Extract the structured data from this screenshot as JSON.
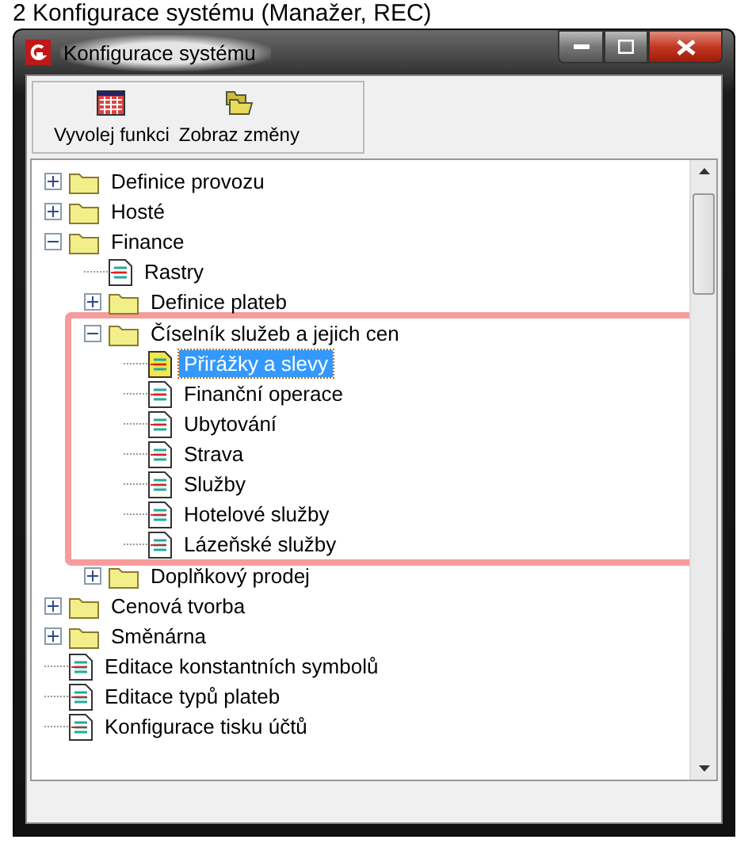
{
  "caption": "2 Konfigurace systému (Manažer, REC)",
  "window": {
    "title": "Konfigurace systému"
  },
  "toolbar": [
    {
      "label": "Vyvolej funkci",
      "kind": "calendar"
    },
    {
      "label": "Zobraz změny",
      "kind": "folders"
    }
  ],
  "tree": [
    {
      "label": "Definice provozu",
      "kind": "folder",
      "expanded": false,
      "selected": false
    },
    {
      "label": "Hosté",
      "kind": "folder",
      "expanded": false,
      "selected": false
    },
    {
      "label": "Finance",
      "kind": "folder",
      "expanded": true,
      "selected": false,
      "children": [
        {
          "label": "Rastry",
          "kind": "document",
          "selected": false
        },
        {
          "label": "Definice plateb",
          "kind": "folder",
          "expanded": false,
          "selected": false
        },
        {
          "label": "Číselník služeb a jejich cen",
          "kind": "folder",
          "expanded": true,
          "selected": false,
          "highlighted": true,
          "children": [
            {
              "label": "Přirážky a slevy",
              "kind": "document",
              "selected": true
            },
            {
              "label": "Finanční operace",
              "kind": "document",
              "selected": false
            },
            {
              "label": "Ubytování",
              "kind": "document",
              "selected": false
            },
            {
              "label": "Strava",
              "kind": "document",
              "selected": false
            },
            {
              "label": "Služby",
              "kind": "document",
              "selected": false
            },
            {
              "label": "Hotelové služby",
              "kind": "document",
              "selected": false
            },
            {
              "label": "Lázeňské služby",
              "kind": "document",
              "selected": false
            }
          ]
        },
        {
          "label": "Doplňkový prodej",
          "kind": "folder",
          "expanded": false,
          "selected": false
        }
      ]
    },
    {
      "label": "Cenová tvorba",
      "kind": "folder",
      "expanded": false,
      "selected": false
    },
    {
      "label": "Směnárna",
      "kind": "folder",
      "expanded": false,
      "selected": false
    },
    {
      "label": "Editace konstantních symbolů",
      "kind": "document",
      "selected": false
    },
    {
      "label": "Editace typů plateb",
      "kind": "document",
      "selected": false
    },
    {
      "label": "Konfigurace tisku účtů",
      "kind": "document",
      "selected": false
    }
  ]
}
